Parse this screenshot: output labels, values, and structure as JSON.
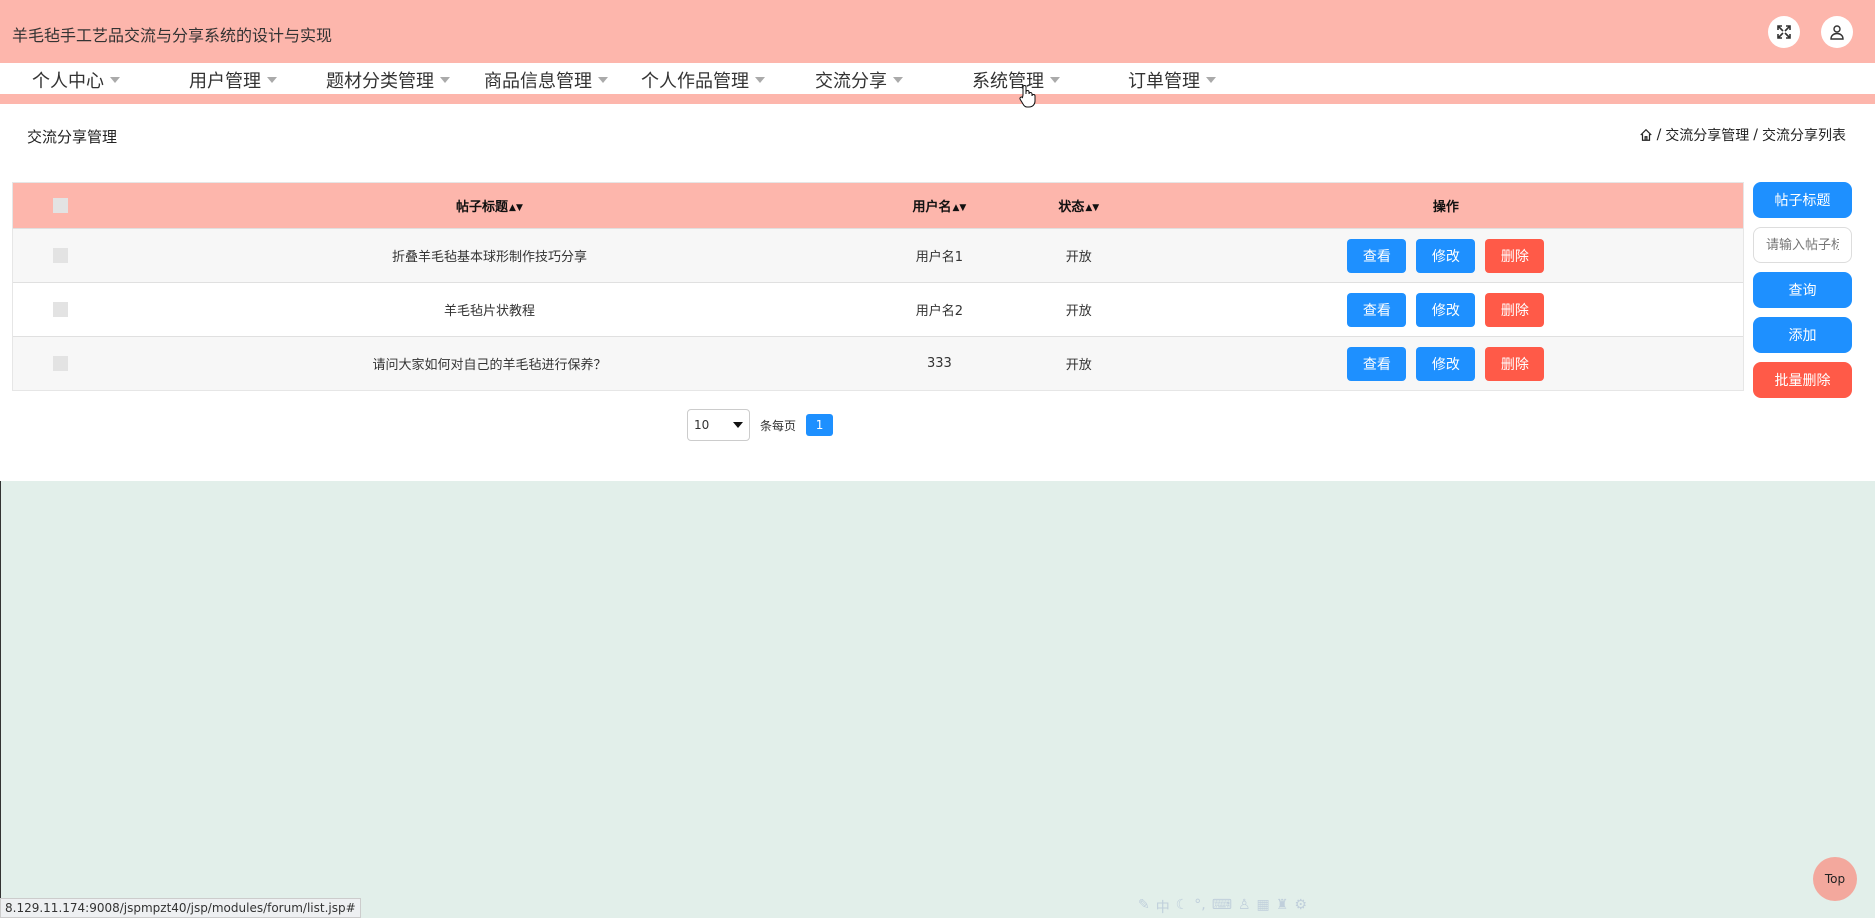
{
  "app": {
    "title": "羊毛毡手工艺品交流与分享系统的设计与实现"
  },
  "header_icons": [
    "fullscreen-icon",
    "user-icon"
  ],
  "nav": [
    "个人中心",
    "用户管理",
    "题材分类管理",
    "商品信息管理",
    "个人作品管理",
    "交流分享",
    "系统管理",
    "订单管理"
  ],
  "page": {
    "heading": "交流分享管理",
    "breadcrumb": [
      "交流分享管理",
      "交流分享列表"
    ]
  },
  "table": {
    "headers": {
      "title": "帖子标题",
      "user": "用户名",
      "status": "状态",
      "ops": "操作"
    },
    "rows": [
      {
        "title": "折叠羊毛毡基本球形制作技巧分享",
        "user": "用户名1",
        "status": "开放"
      },
      {
        "title": "羊毛毡片状教程",
        "user": "用户名2",
        "status": "开放"
      },
      {
        "title": "请问大家如何对自己的羊毛毡进行保养？",
        "user": "333",
        "status": "开放"
      }
    ],
    "row_actions": {
      "view": "查看",
      "edit": "修改",
      "delete": "删除"
    }
  },
  "side": {
    "field_label": "帖子标题",
    "search_placeholder": "请输入帖子标题",
    "query": "查询",
    "add": "添加",
    "batch_delete": "批量删除"
  },
  "pagination": {
    "page_size": "10",
    "per_page_label": "条每页",
    "current_page": "1"
  },
  "status_url": "8.129.11.174:9008/jspmpzt40/jsp/modules/forum/list.jsp#",
  "top_button": "Top",
  "colors": {
    "accent": "#fdb6ac",
    "primary": "#1e90ff",
    "danger": "#ff5a48",
    "page_bg": "#e2efea"
  }
}
